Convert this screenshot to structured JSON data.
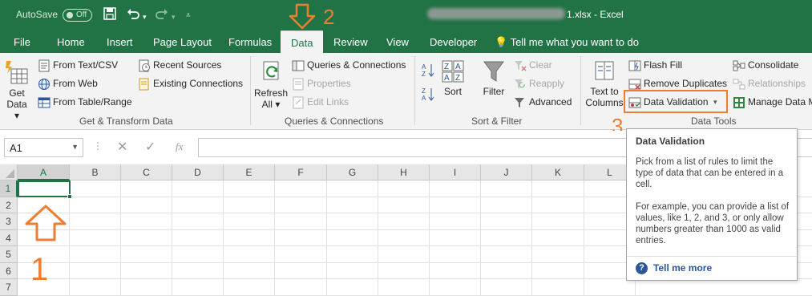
{
  "titlebar": {
    "autosave_label": "AutoSave",
    "autosave_state": "Off",
    "file_suffix": "1.xlsx",
    "app_separator": "-",
    "app_name": "Excel"
  },
  "tabs": [
    {
      "label": "File"
    },
    {
      "label": "Home"
    },
    {
      "label": "Insert"
    },
    {
      "label": "Page Layout"
    },
    {
      "label": "Formulas"
    },
    {
      "label": "Data"
    },
    {
      "label": "Review"
    },
    {
      "label": "View"
    },
    {
      "label": "Developer"
    }
  ],
  "active_tab": "Data",
  "tell_me": "Tell me what you want to do",
  "ribbon": {
    "get_transform": {
      "get_data_line1": "Get",
      "get_data_line2": "Data",
      "from_text_csv": "From Text/CSV",
      "from_web": "From Web",
      "from_table_range": "From Table/Range",
      "recent_sources": "Recent Sources",
      "existing_connections": "Existing Connections",
      "group_label": "Get & Transform Data"
    },
    "queries": {
      "refresh_line1": "Refresh",
      "refresh_line2": "All",
      "queries_connections": "Queries & Connections",
      "properties": "Properties",
      "edit_links": "Edit Links",
      "group_label": "Queries & Connections"
    },
    "sort_filter": {
      "sort": "Sort",
      "filter": "Filter",
      "clear": "Clear",
      "reapply": "Reapply",
      "advanced": "Advanced",
      "group_label": "Sort & Filter"
    },
    "data_tools": {
      "text_to_line1": "Text to",
      "text_to_line2": "Columns",
      "flash_fill": "Flash Fill",
      "remove_duplicates": "Remove Duplicates",
      "data_validation": "Data Validation",
      "consolidate": "Consolidate",
      "relationships": "Relationships",
      "manage_data_model": "Manage Data M",
      "group_label": "Data Tools"
    }
  },
  "formula_bar": {
    "name_box": "A1",
    "fx": "fx"
  },
  "grid": {
    "columns": [
      "A",
      "B",
      "C",
      "D",
      "E",
      "F",
      "G",
      "H",
      "I",
      "J",
      "K",
      "L"
    ],
    "rows": [
      "1",
      "2",
      "3",
      "4",
      "5",
      "6",
      "7"
    ],
    "selected_cell": "A1"
  },
  "tooltip": {
    "title": "Data Validation",
    "paragraph1": "Pick from a list of rules to limit the type of data that can be entered in a cell.",
    "paragraph2": "For example, you can provide a list of values, like 1, 2, and 3, or only allow numbers greater than 1000 as valid entries.",
    "link": "Tell me more"
  },
  "annotations": {
    "step1": "1",
    "step2": "2",
    "step3": "3",
    "color": "#ed7d31"
  },
  "colors": {
    "excel_green": "#217346",
    "ribbon_bg": "#f3f3f3",
    "link_blue": "#2b579a"
  }
}
